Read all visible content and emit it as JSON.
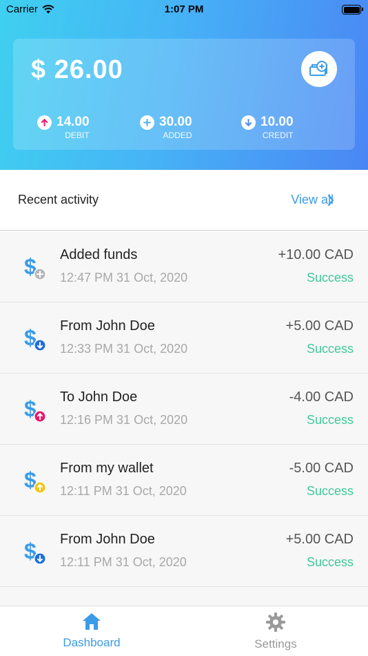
{
  "status_bar": {
    "carrier": "Carrier",
    "time": "1:07 PM"
  },
  "wallet": {
    "balance": "$ 26.00",
    "add_funds_icon": "wallet-add-icon",
    "stats": [
      {
        "value": "14.00",
        "label": "DEBIT",
        "icon": "arrow-up-icon",
        "color": "#e8186d"
      },
      {
        "value": "30.00",
        "label": "ADDED",
        "icon": "plus-icon",
        "color": "#4ab2f0"
      },
      {
        "value": "10.00",
        "label": "CREDIT",
        "icon": "arrow-down-icon",
        "color": "#4a8ff0"
      }
    ]
  },
  "activity": {
    "title": "Recent activity",
    "view_all": "View all",
    "items": [
      {
        "title": "Added funds",
        "time": "12:47 PM 31 Oct, 2020",
        "amount": "+10.00 CAD",
        "status": "Success",
        "badge": "plus",
        "badge_color": "#b7b7b7"
      },
      {
        "title": "From John Doe",
        "time": "12:33 PM 31 Oct, 2020",
        "amount": "+5.00 CAD",
        "status": "Success",
        "badge": "down",
        "badge_color": "#1e6fd9"
      },
      {
        "title": "To John Doe",
        "time": "12:16 PM 31 Oct, 2020",
        "amount": "-4.00 CAD",
        "status": "Success",
        "badge": "up",
        "badge_color": "#e8186d"
      },
      {
        "title": "From my wallet",
        "time": "12:11 PM 31 Oct, 2020",
        "amount": "-5.00 CAD",
        "status": "Success",
        "badge": "up",
        "badge_color": "#f5c518"
      },
      {
        "title": "From John Doe",
        "time": "12:11 PM 31 Oct, 2020",
        "amount": "+5.00 CAD",
        "status": "Success",
        "badge": "down",
        "badge_color": "#1e6fd9"
      }
    ]
  },
  "tabbar": {
    "tabs": [
      {
        "label": "Dashboard",
        "icon": "home-icon",
        "active": true,
        "color": "#3a9be8"
      },
      {
        "label": "Settings",
        "icon": "gear-icon",
        "active": false,
        "color": "#9a9a9a"
      }
    ]
  },
  "colors": {
    "accent": "#3a9be8",
    "success": "#3ec99b",
    "dollar": "#3a9be8"
  }
}
